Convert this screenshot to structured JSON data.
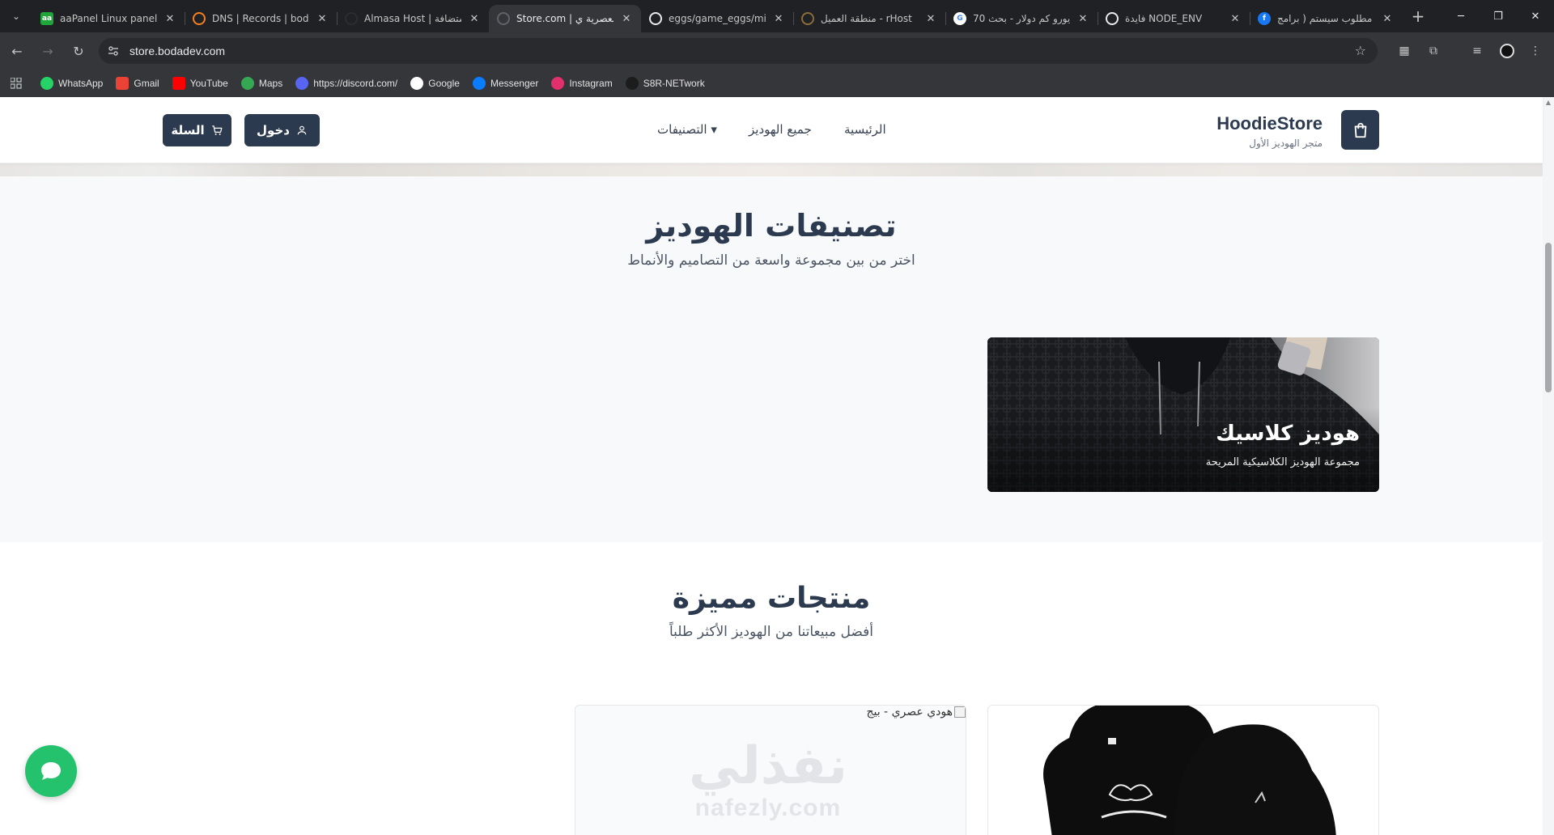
{
  "browser": {
    "tabs": [
      {
        "title": "aaPanel Linux panel -",
        "icon": "aapanel-icon",
        "icon_text": "aa",
        "icon_color": "#20a53a",
        "active": false
      },
      {
        "title": "DNS | Records | boda",
        "icon": "cloudflare-icon",
        "icon_text": "",
        "icon_color": "#f38020",
        "active": false
      },
      {
        "title": "Almasa Host | استضافة",
        "icon": "almasa-icon",
        "icon_text": "",
        "icon_color": "#2b2d30",
        "active": false
      },
      {
        "title": "Store.com | العصرية ي",
        "icon": "globe-icon",
        "icon_text": "",
        "icon_color": "#5f6368",
        "active": true
      },
      {
        "title": "eggs/game_eggs/mi",
        "icon": "github-icon",
        "icon_text": "",
        "icon_color": "#e8eaed",
        "active": false
      },
      {
        "title": "منطقة العميل - rHost",
        "icon": "host-icon",
        "icon_text": "",
        "icon_color": "#8a6d3b",
        "active": false
      },
      {
        "title": "70 يورو كم دولار - بحث",
        "icon": "google-icon",
        "icon_text": "G",
        "icon_color": "#ffffff",
        "active": false
      },
      {
        "title": "فايدة NODE_ENV",
        "icon": "openai-icon",
        "icon_text": "",
        "icon_color": "#e8eaed",
        "active": false
      },
      {
        "title": "مطلوب سيستم ( برامج",
        "icon": "facebook-icon",
        "icon_text": "f",
        "icon_color": "#1877f2",
        "active": false
      }
    ],
    "url": "store.bodadev.com",
    "bookmarks": [
      {
        "label": "WhatsApp",
        "icon": "whatsapp-icon",
        "color": "#25d366"
      },
      {
        "label": "Gmail",
        "icon": "gmail-icon",
        "color": "#ea4335"
      },
      {
        "label": "YouTube",
        "icon": "youtube-icon",
        "color": "#ff0000"
      },
      {
        "label": "Maps",
        "icon": "maps-icon",
        "color": "#34a853"
      },
      {
        "label": "https://discord.com/",
        "icon": "discord-icon",
        "color": "#5865f2"
      },
      {
        "label": "Google",
        "icon": "google-icon",
        "color": "#ffffff"
      },
      {
        "label": "Messenger",
        "icon": "messenger-icon",
        "color": "#0a7cff"
      },
      {
        "label": "Instagram",
        "icon": "instagram-icon",
        "color": "#e1306c"
      },
      {
        "label": "S8R-NETwork",
        "icon": "s8r-icon",
        "color": "#1c1c1c"
      }
    ]
  },
  "site": {
    "brand": "HoodieStore",
    "tagline": "متجر الهوديز الأول",
    "nav": {
      "home": "الرئيسية",
      "all": "جميع الهوديز",
      "categories": "التصنيفات ▾"
    },
    "login_label": "دخول",
    "cart_label": "السلة",
    "accent_color": "#2b3a4e"
  },
  "categories_section": {
    "title": "تصنيفات الهوديز",
    "subtitle": "اختر من بين مجموعة واسعة من التصاميم والأنماط",
    "cards": [
      {
        "title": "هوديز كلاسيك",
        "description": "مجموعة الهوديز الكلاسيكية المريحة"
      }
    ]
  },
  "featured_section": {
    "title": "منتجات مميزة",
    "subtitle": "أفضل مبيعاتنا من الهوديز الأكثر طلباً",
    "products": [
      {
        "image_alt": "هودي عصري - بيج",
        "watermark_ar": "نفذلي",
        "watermark_en": "nafezly.com"
      }
    ]
  }
}
